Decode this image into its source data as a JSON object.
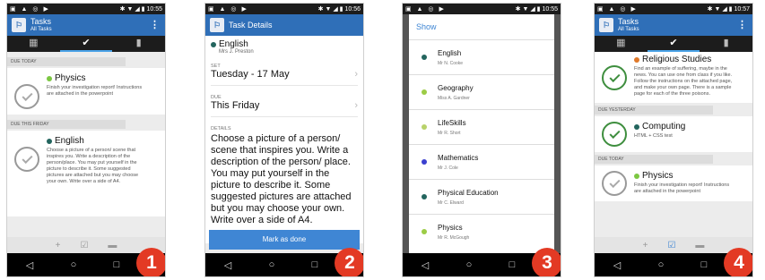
{
  "status_bar": {
    "left_icons": "▣ ▲ ◎ ▶",
    "right_icons": "✱ ▼ ◢ ▮",
    "times": [
      "10:55",
      "10:56",
      "10:55",
      "10:57"
    ]
  },
  "app": {
    "title": "Tasks",
    "subtitle": "All Tasks",
    "logo_glyph": "⚐",
    "kebab_glyph": "⋮",
    "tabs": [
      {
        "name": "calendar-icon",
        "glyph": "▦"
      },
      {
        "name": "check-icon",
        "glyph": "✔"
      },
      {
        "name": "bookmark-icon",
        "glyph": "▮"
      }
    ],
    "bottom_bar": {
      "add": "+",
      "check": "☑",
      "folder": "▬"
    },
    "nav": {
      "back": "◁",
      "home": "○",
      "recent": "□"
    }
  },
  "screen1": {
    "badge": "1",
    "sections": [
      {
        "header": "DUE TODAY",
        "task": {
          "subject": "Physics",
          "color": "#7cc742",
          "description": "Finish your investigation report! Instructions are attached in the powerpoint"
        }
      },
      {
        "header": "DUE THIS FRIDAY",
        "task": {
          "subject": "English",
          "color": "#23655e",
          "description": "Choose a picture of a person/ scene that inspires you.  Write a description of the person/place. You may put yourself in the picture to describe it. Some suggested pictures are attached but you may choose your own. Write over a side of A4."
        }
      }
    ]
  },
  "screen2": {
    "badge": "2",
    "title": "Task Details",
    "subject": "English",
    "subject_color": "#23655e",
    "teacher": "Mrs J. Preston",
    "set_label": "SET",
    "set_value": "Tuesday - 17 May",
    "due_label": "DUE",
    "due_value": "This Friday",
    "details_label": "DETAILS",
    "details": "Choose a picture of a person/ scene that inspires you.  Write a description of the person/ place.  You may put yourself in the picture to describe it.  Some suggested pictures are attached but you may choose your own. Write over a side of A4.",
    "mark_done": "Mark as done",
    "chevron": "›"
  },
  "screen3": {
    "badge": "3",
    "dialog_title": "Show",
    "subjects": [
      {
        "name": "English",
        "teacher": "Mr N. Cooke",
        "color": "#23655e"
      },
      {
        "name": "Geography",
        "teacher": "Miss A. Gardner",
        "color": "#9ccc45"
      },
      {
        "name": "LifeSkills",
        "teacher": "Mr R. Short",
        "color": "#b8d26a"
      },
      {
        "name": "Mathematics",
        "teacher": "Mr J. Cole",
        "color": "#3a3fcf"
      },
      {
        "name": "Physical Education",
        "teacher": "Mr C. Elward",
        "color": "#23655e"
      },
      {
        "name": "Physics",
        "teacher": "Mr R. McGough",
        "color": "#9ccc45"
      }
    ]
  },
  "screen4": {
    "badge": "4",
    "top_task": {
      "subject": "Religious Studies",
      "color": "#e0792a",
      "description": "Find an example of suffering, maybe in the news. You can use one from class if you like.  Follow the instructions on the attached page, and make your own page.  There is a sample page for each of the three poisons."
    },
    "sections": [
      {
        "header": "DUE YESTERDAY",
        "task": {
          "subject": "Computing",
          "color": "#23655e",
          "description": "HTML + CSS test"
        }
      },
      {
        "header": "DUE TODAY",
        "task": {
          "subject": "Physics",
          "color": "#7cc742",
          "description": "Finish your investigation report! Instructions are attached in the powerpoint"
        }
      }
    ]
  }
}
